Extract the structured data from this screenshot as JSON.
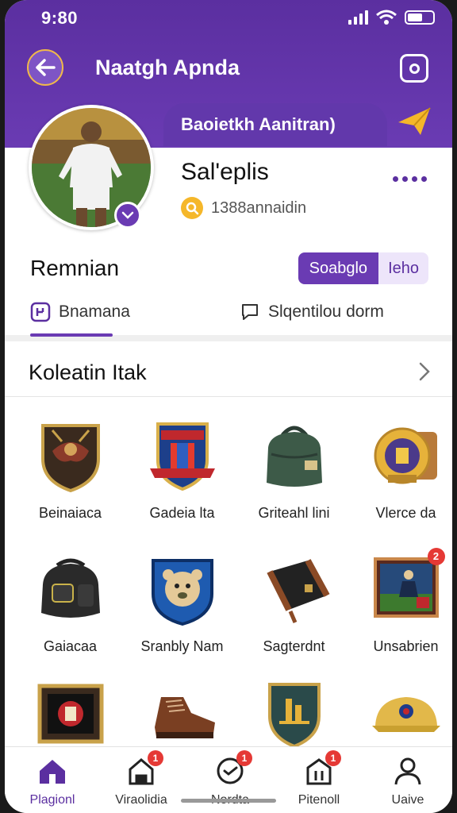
{
  "status": {
    "time": "9:80"
  },
  "header": {
    "title": "Naatgh Apnda",
    "banner": "Baoietkh Aanitran)"
  },
  "profile": {
    "name": "Sal'eplis",
    "meta": "1388annaidin"
  },
  "section": {
    "label": "Remnian",
    "segment_active": "Soabglo",
    "segment_other": "Ieho"
  },
  "tabs": [
    {
      "label": "Bnamana"
    },
    {
      "label": "Slqentilou dorm"
    }
  ],
  "collection": {
    "title": "Koleatin Itak",
    "items": [
      {
        "label": "Beinaiaca",
        "icon": "eagle-shield-icon"
      },
      {
        "label": "Gadeia lta",
        "icon": "crest-badge-icon"
      },
      {
        "label": "Griteahl lini",
        "icon": "green-bag-icon"
      },
      {
        "label": "Vlerce da",
        "icon": "gold-badge-icon"
      },
      {
        "label": "Gaiacaa",
        "icon": "black-backpack-icon"
      },
      {
        "label": "Sranbly Nam",
        "icon": "bear-emblem-icon"
      },
      {
        "label": "Sagterdnt",
        "icon": "duffel-bag-icon"
      },
      {
        "label": "Unsabrien",
        "icon": "player-card-icon",
        "badge": "2"
      },
      {
        "label": "",
        "icon": "framed-crest-icon"
      },
      {
        "label": "",
        "icon": "boot-icon"
      },
      {
        "label": "",
        "icon": "trophy-shield-icon"
      },
      {
        "label": "",
        "icon": "cap-icon"
      }
    ]
  },
  "bottom_nav": [
    {
      "label": "Plagionl",
      "icon": "home-icon",
      "active": true
    },
    {
      "label": "Viraolidia",
      "icon": "store-icon",
      "badge": "1"
    },
    {
      "label": "Nordta",
      "icon": "chat-icon",
      "badge": "1"
    },
    {
      "label": "Pitenoll",
      "icon": "calendar-icon",
      "badge": "1"
    },
    {
      "label": "Uaive",
      "icon": "user-icon"
    }
  ],
  "colors": {
    "primary": "#6a3bb3",
    "accent": "#f5b72a",
    "badge": "#e53935"
  }
}
